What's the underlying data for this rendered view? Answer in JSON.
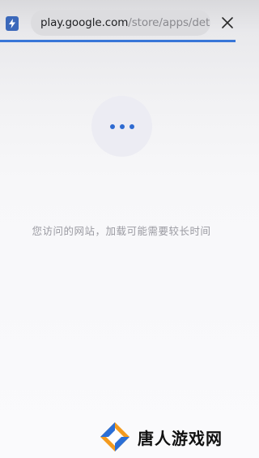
{
  "browser": {
    "url_host": "play.google.com",
    "url_path": "/store/apps/details?",
    "progress": 0.97,
    "app_icon": "lightning-shield-icon",
    "close_icon": "close-icon"
  },
  "page": {
    "status_message": "您访问的网站，加载可能需要较长时间",
    "loading_icon": "ellipsis-loading-icon"
  },
  "watermark": {
    "text": "唐人游戏网",
    "logo": "tangren-logo"
  },
  "colors": {
    "accent": "#3876d8",
    "dots": "#2e6ad1",
    "status_text": "#9b9ba2"
  }
}
